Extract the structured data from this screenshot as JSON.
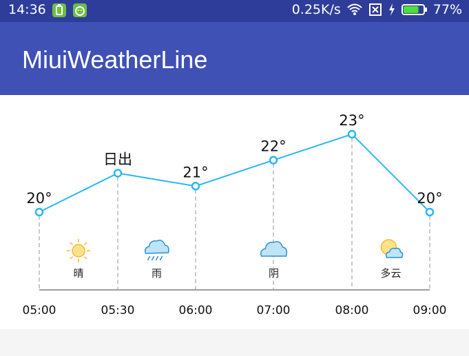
{
  "status_bar": {
    "time": "14:36",
    "speed": "0.25K/s",
    "battery": "77%",
    "battery_level": 0.77,
    "icons": [
      "battery-app-icon",
      "android-app-icon",
      "wifi-icon",
      "sim-off-icon",
      "charging-icon",
      "battery-icon"
    ]
  },
  "app_bar": {
    "title": "MiuiWeatherLine"
  },
  "chart_data": {
    "type": "line",
    "x": [
      "05:00",
      "05:30",
      "06:00",
      "07:00",
      "08:00",
      "09:00"
    ],
    "temperatures": [
      20,
      21.5,
      21,
      22,
      23,
      20
    ],
    "point_labels": [
      "20°",
      "日出",
      "21°",
      "22°",
      "23°",
      "20°"
    ],
    "weather_segments": [
      {
        "label": "晴",
        "icon": "sun-icon"
      },
      {
        "label": "雨",
        "icon": "rain-cloud-icon"
      },
      {
        "label": "阴",
        "icon": "cloud-icon"
      },
      {
        "label": "多云",
        "icon": "partly-cloudy-icon"
      }
    ],
    "line_color": "#29b6f6",
    "dashed_dividers": true
  }
}
